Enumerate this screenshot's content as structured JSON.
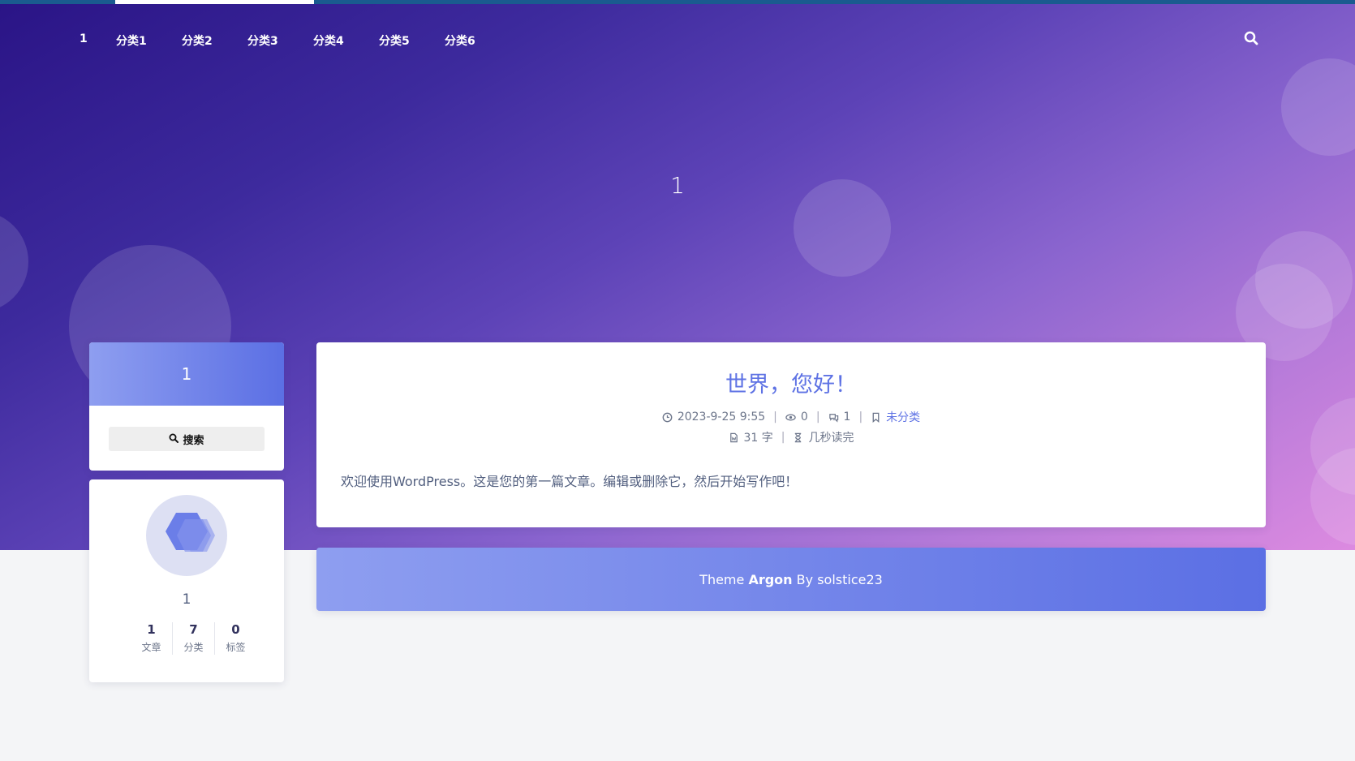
{
  "nav": {
    "brand": "1",
    "items": [
      "分类1",
      "分类2",
      "分类3",
      "分类4",
      "分类5",
      "分类6"
    ],
    "search_icon": "search-icon"
  },
  "banner": {
    "title": "1"
  },
  "sidebar": {
    "header_title": "1",
    "search_label": "搜索",
    "profile": {
      "name": "1",
      "stats": [
        {
          "value": "1",
          "label": "文章"
        },
        {
          "value": "7",
          "label": "分类"
        },
        {
          "value": "0",
          "label": "标签"
        }
      ]
    }
  },
  "post": {
    "title": "世界，您好！",
    "date": "2023-9-25 9:55",
    "views": "0",
    "comments": "1",
    "category": "未分类",
    "words": "31 字",
    "read_time": "几秒读完",
    "excerpt": "欢迎使用WordPress。这是您的第一篇文章。编辑或删除它，然后开始写作吧！"
  },
  "footer": {
    "prefix": "Theme",
    "theme_name": "Argon",
    "suffix": "By solstice23"
  },
  "colors": {
    "accent": "#5e72e4",
    "banner_start": "#2a1486",
    "banner_end": "#dc8ae0"
  }
}
